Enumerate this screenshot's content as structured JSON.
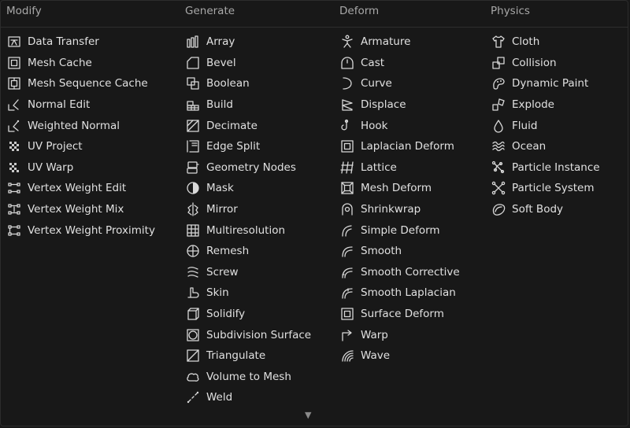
{
  "columns": [
    {
      "title": "Modify",
      "items": [
        {
          "label": "Data Transfer",
          "icon": "data-transfer-icon"
        },
        {
          "label": "Mesh Cache",
          "icon": "mesh-cache-icon"
        },
        {
          "label": "Mesh Sequence Cache",
          "icon": "mesh-sequence-cache-icon"
        },
        {
          "label": "Normal Edit",
          "icon": "normal-edit-icon"
        },
        {
          "label": "Weighted Normal",
          "icon": "weighted-normal-icon"
        },
        {
          "label": "UV Project",
          "icon": "uv-project-icon"
        },
        {
          "label": "UV Warp",
          "icon": "uv-warp-icon"
        },
        {
          "label": "Vertex Weight Edit",
          "icon": "vertex-weight-edit-icon"
        },
        {
          "label": "Vertex Weight Mix",
          "icon": "vertex-weight-mix-icon"
        },
        {
          "label": "Vertex Weight Proximity",
          "icon": "vertex-weight-proximity-icon"
        }
      ]
    },
    {
      "title": "Generate",
      "items": [
        {
          "label": "Array",
          "icon": "array-icon"
        },
        {
          "label": "Bevel",
          "icon": "bevel-icon"
        },
        {
          "label": "Boolean",
          "icon": "boolean-icon"
        },
        {
          "label": "Build",
          "icon": "build-icon"
        },
        {
          "label": "Decimate",
          "icon": "decimate-icon"
        },
        {
          "label": "Edge Split",
          "icon": "edge-split-icon"
        },
        {
          "label": "Geometry Nodes",
          "icon": "geometry-nodes-icon"
        },
        {
          "label": "Mask",
          "icon": "mask-icon"
        },
        {
          "label": "Mirror",
          "icon": "mirror-icon"
        },
        {
          "label": "Multiresolution",
          "icon": "multiresolution-icon"
        },
        {
          "label": "Remesh",
          "icon": "remesh-icon"
        },
        {
          "label": "Screw",
          "icon": "screw-icon"
        },
        {
          "label": "Skin",
          "icon": "skin-icon"
        },
        {
          "label": "Solidify",
          "icon": "solidify-icon"
        },
        {
          "label": "Subdivision Surface",
          "icon": "subdivision-surface-icon"
        },
        {
          "label": "Triangulate",
          "icon": "triangulate-icon"
        },
        {
          "label": "Volume to Mesh",
          "icon": "volume-to-mesh-icon"
        },
        {
          "label": "Weld",
          "icon": "weld-icon"
        }
      ]
    },
    {
      "title": "Deform",
      "items": [
        {
          "label": "Armature",
          "icon": "armature-icon"
        },
        {
          "label": "Cast",
          "icon": "cast-icon"
        },
        {
          "label": "Curve",
          "icon": "curve-icon"
        },
        {
          "label": "Displace",
          "icon": "displace-icon"
        },
        {
          "label": "Hook",
          "icon": "hook-icon"
        },
        {
          "label": "Laplacian Deform",
          "icon": "laplacian-deform-icon"
        },
        {
          "label": "Lattice",
          "icon": "lattice-icon"
        },
        {
          "label": "Mesh Deform",
          "icon": "mesh-deform-icon"
        },
        {
          "label": "Shrinkwrap",
          "icon": "shrinkwrap-icon"
        },
        {
          "label": "Simple Deform",
          "icon": "simple-deform-icon"
        },
        {
          "label": "Smooth",
          "icon": "smooth-icon"
        },
        {
          "label": "Smooth Corrective",
          "icon": "smooth-corrective-icon"
        },
        {
          "label": "Smooth Laplacian",
          "icon": "smooth-laplacian-icon"
        },
        {
          "label": "Surface Deform",
          "icon": "surface-deform-icon"
        },
        {
          "label": "Warp",
          "icon": "warp-icon"
        },
        {
          "label": "Wave",
          "icon": "wave-icon"
        }
      ]
    },
    {
      "title": "Physics",
      "items": [
        {
          "label": "Cloth",
          "icon": "cloth-icon"
        },
        {
          "label": "Collision",
          "icon": "collision-icon"
        },
        {
          "label": "Dynamic Paint",
          "icon": "dynamic-paint-icon"
        },
        {
          "label": "Explode",
          "icon": "explode-icon"
        },
        {
          "label": "Fluid",
          "icon": "fluid-icon"
        },
        {
          "label": "Ocean",
          "icon": "ocean-icon"
        },
        {
          "label": "Particle Instance",
          "icon": "particle-instance-icon"
        },
        {
          "label": "Particle System",
          "icon": "particle-system-icon"
        },
        {
          "label": "Soft Body",
          "icon": "soft-body-icon"
        }
      ]
    }
  ],
  "scroll_indicator": "▼",
  "colors": {
    "background": "#181818",
    "text": "#e0e0e0",
    "header": "#a8a8a8",
    "icon": "#d8d8d8"
  }
}
